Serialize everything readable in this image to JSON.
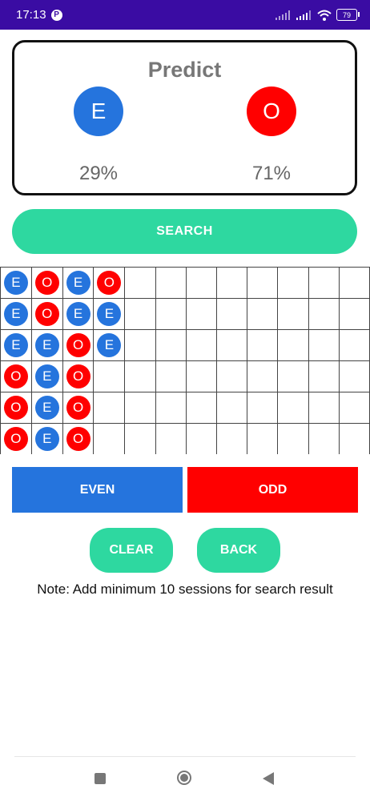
{
  "status_bar": {
    "time": "17:13",
    "app_badge": "P",
    "battery": "79",
    "icons": [
      "signal-icon",
      "signal-icon",
      "wifi-icon",
      "battery-icon"
    ]
  },
  "predict": {
    "title": "Predict",
    "even_letter": "E",
    "odd_letter": "O",
    "even_percent": "29%",
    "odd_percent": "71%"
  },
  "search": {
    "label": "SEARCH"
  },
  "grid": {
    "columns": 12,
    "rows": [
      [
        "E",
        "O",
        "E",
        "O",
        "",
        "",
        "",
        "",
        "",
        "",
        "",
        ""
      ],
      [
        "E",
        "O",
        "E",
        "E",
        "",
        "",
        "",
        "",
        "",
        "",
        "",
        ""
      ],
      [
        "E",
        "E",
        "O",
        "E",
        "",
        "",
        "",
        "",
        "",
        "",
        "",
        ""
      ],
      [
        "O",
        "E",
        "O",
        "",
        "",
        "",
        "",
        "",
        "",
        "",
        "",
        ""
      ],
      [
        "O",
        "E",
        "O",
        "",
        "",
        "",
        "",
        "",
        "",
        "",
        "",
        ""
      ],
      [
        "O",
        "E",
        "O",
        "",
        "",
        "",
        "",
        "",
        "",
        "",
        "",
        ""
      ]
    ]
  },
  "buttons": {
    "even": "EVEN",
    "odd": "ODD",
    "clear": "CLEAR",
    "back": "BACK"
  },
  "note": "Note: Add minimum 10 sessions for search result",
  "colors": {
    "status_bar": "#3a0ca3",
    "even": "#2574dd",
    "odd": "#ff0000",
    "accent": "#2ed8a0"
  }
}
